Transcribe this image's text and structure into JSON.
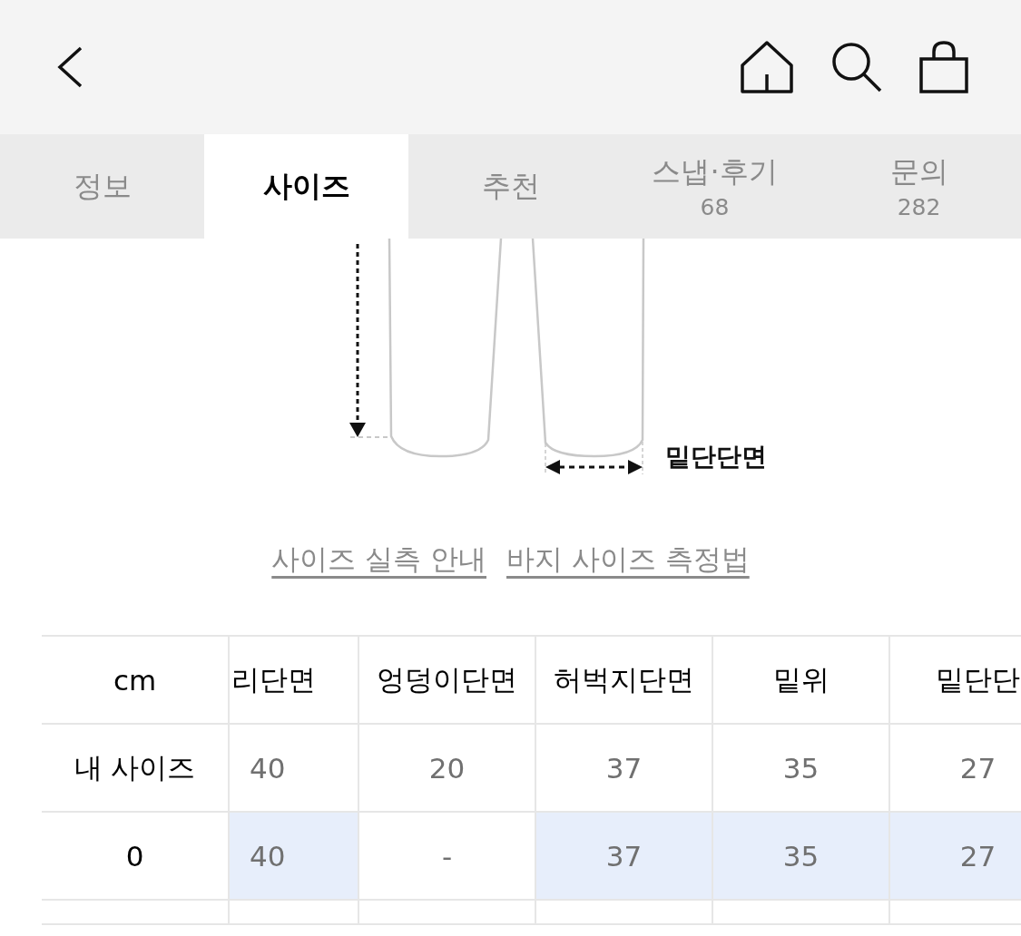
{
  "tabs": [
    {
      "label": "정보",
      "selected": false
    },
    {
      "label": "사이즈",
      "selected": true
    },
    {
      "label": "추천",
      "selected": false
    },
    {
      "label": "스냅·후기",
      "count": "68",
      "selected": false
    },
    {
      "label": "문의",
      "count": "282",
      "selected": false
    }
  ],
  "diagram": {
    "hem_label": "밑단단면"
  },
  "links": [
    "사이즈 실측 안내",
    "바지 사이즈 측정법"
  ],
  "size_table": {
    "corner": "cm",
    "columns": [
      "리단면",
      "엉덩이단면",
      "허벅지단면",
      "밑위",
      "밑단단"
    ],
    "rows": [
      {
        "label": "내 사이즈",
        "cells": [
          {
            "value": "40",
            "highlighted": false
          },
          {
            "value": "20",
            "highlighted": false
          },
          {
            "value": "37",
            "highlighted": false
          },
          {
            "value": "35",
            "highlighted": false
          },
          {
            "value": "27",
            "highlighted": false
          }
        ]
      },
      {
        "label": "0",
        "cells": [
          {
            "value": "40",
            "highlighted": true
          },
          {
            "value": "-",
            "highlighted": false
          },
          {
            "value": "37",
            "highlighted": true
          },
          {
            "value": "35",
            "highlighted": true
          },
          {
            "value": "27",
            "highlighted": true
          }
        ]
      }
    ]
  }
}
